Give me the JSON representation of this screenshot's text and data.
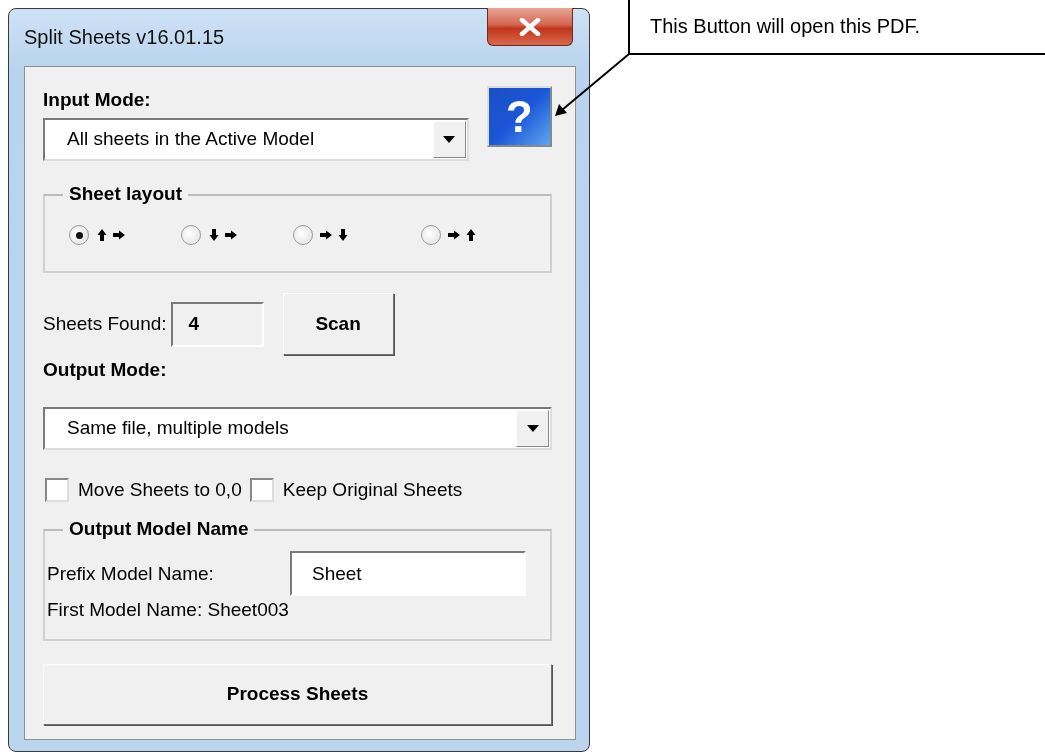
{
  "window": {
    "title": "Split Sheets v16.01.15"
  },
  "input_mode": {
    "label": "Input Mode:",
    "value": "All sheets in the Active Model"
  },
  "help_button": "?",
  "sheet_layout": {
    "title": "Sheet layout",
    "options": [
      {
        "kind": "up-right",
        "selected": true
      },
      {
        "kind": "down-right",
        "selected": false
      },
      {
        "kind": "right-down",
        "selected": false
      },
      {
        "kind": "right-up",
        "selected": false
      }
    ]
  },
  "sheets_found": {
    "label": "Sheets Found:",
    "value": "4"
  },
  "scan_button": "Scan",
  "output_mode": {
    "label": "Output Mode:",
    "value": "Same file, multiple models"
  },
  "checkboxes": [
    {
      "label": "Move Sheets to 0,0",
      "checked": false
    },
    {
      "label": "Keep Original Sheets",
      "checked": false
    }
  ],
  "output_model_name": {
    "title": "Output Model Name",
    "prefix_label": "Prefix Model Name:",
    "prefix_value": "Sheet",
    "first_model_name": "First Model Name: Sheet003"
  },
  "process_button": "Process Sheets",
  "callout": {
    "text": "This Button will open this PDF."
  }
}
